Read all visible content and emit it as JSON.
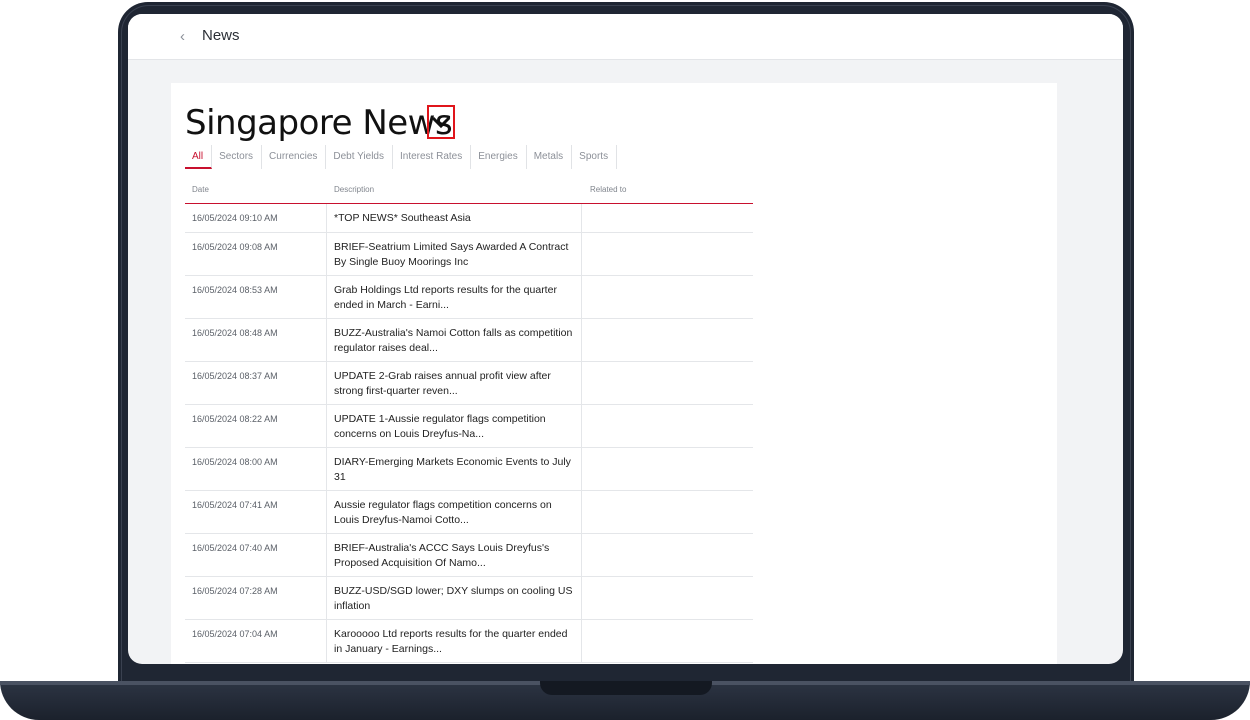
{
  "topbar": {
    "back_label": "‹",
    "title": "News"
  },
  "page": {
    "title": "Singapore News"
  },
  "tabs": [
    "All",
    "Sectors",
    "Currencies",
    "Debt Yields",
    "Interest Rates",
    "Energies",
    "Metals",
    "Sports"
  ],
  "active_tab": "All",
  "table": {
    "headers": {
      "date": "Date",
      "description": "Description",
      "related": "Related to"
    },
    "rows": [
      {
        "date": "16/05/2024 09:10 AM",
        "description": "*TOP NEWS* Southeast Asia",
        "related": ""
      },
      {
        "date": "16/05/2024 09:08 AM",
        "description": "BRIEF-Seatrium Limited Says Awarded A Contract By Single Buoy Moorings Inc",
        "related": ""
      },
      {
        "date": "16/05/2024 08:53 AM",
        "description": "Grab Holdings Ltd reports results for the quarter ended in March - Earni...",
        "related": ""
      },
      {
        "date": "16/05/2024 08:48 AM",
        "description": "BUZZ-Australia's Namoi Cotton falls as competition regulator raises deal...",
        "related": ""
      },
      {
        "date": "16/05/2024 08:37 AM",
        "description": "UPDATE 2-Grab raises annual profit view after strong first-quarter reven...",
        "related": ""
      },
      {
        "date": "16/05/2024 08:22 AM",
        "description": "UPDATE 1-Aussie regulator flags competition concerns on Louis Dreyfus-Na...",
        "related": ""
      },
      {
        "date": "16/05/2024 08:00 AM",
        "description": "DIARY-Emerging Markets Economic Events to July 31",
        "related": ""
      },
      {
        "date": "16/05/2024 07:41 AM",
        "description": "Aussie regulator flags competition concerns on Louis Dreyfus-Namoi Cotto...",
        "related": ""
      },
      {
        "date": "16/05/2024 07:40 AM",
        "description": "BRIEF-Australia's ACCC Says Louis Dreyfus's Proposed Acquisition Of Namo...",
        "related": ""
      },
      {
        "date": "16/05/2024 07:28 AM",
        "description": "BUZZ-USD/SGD lower; DXY slumps on cooling US inflation",
        "related": ""
      },
      {
        "date": "16/05/2024 07:04 AM",
        "description": "Karooooo Ltd reports results for the quarter ended in January - Earnings...",
        "related": ""
      }
    ]
  },
  "colors": {
    "accent": "#c8102e",
    "highlight_box": "#e0151b"
  }
}
